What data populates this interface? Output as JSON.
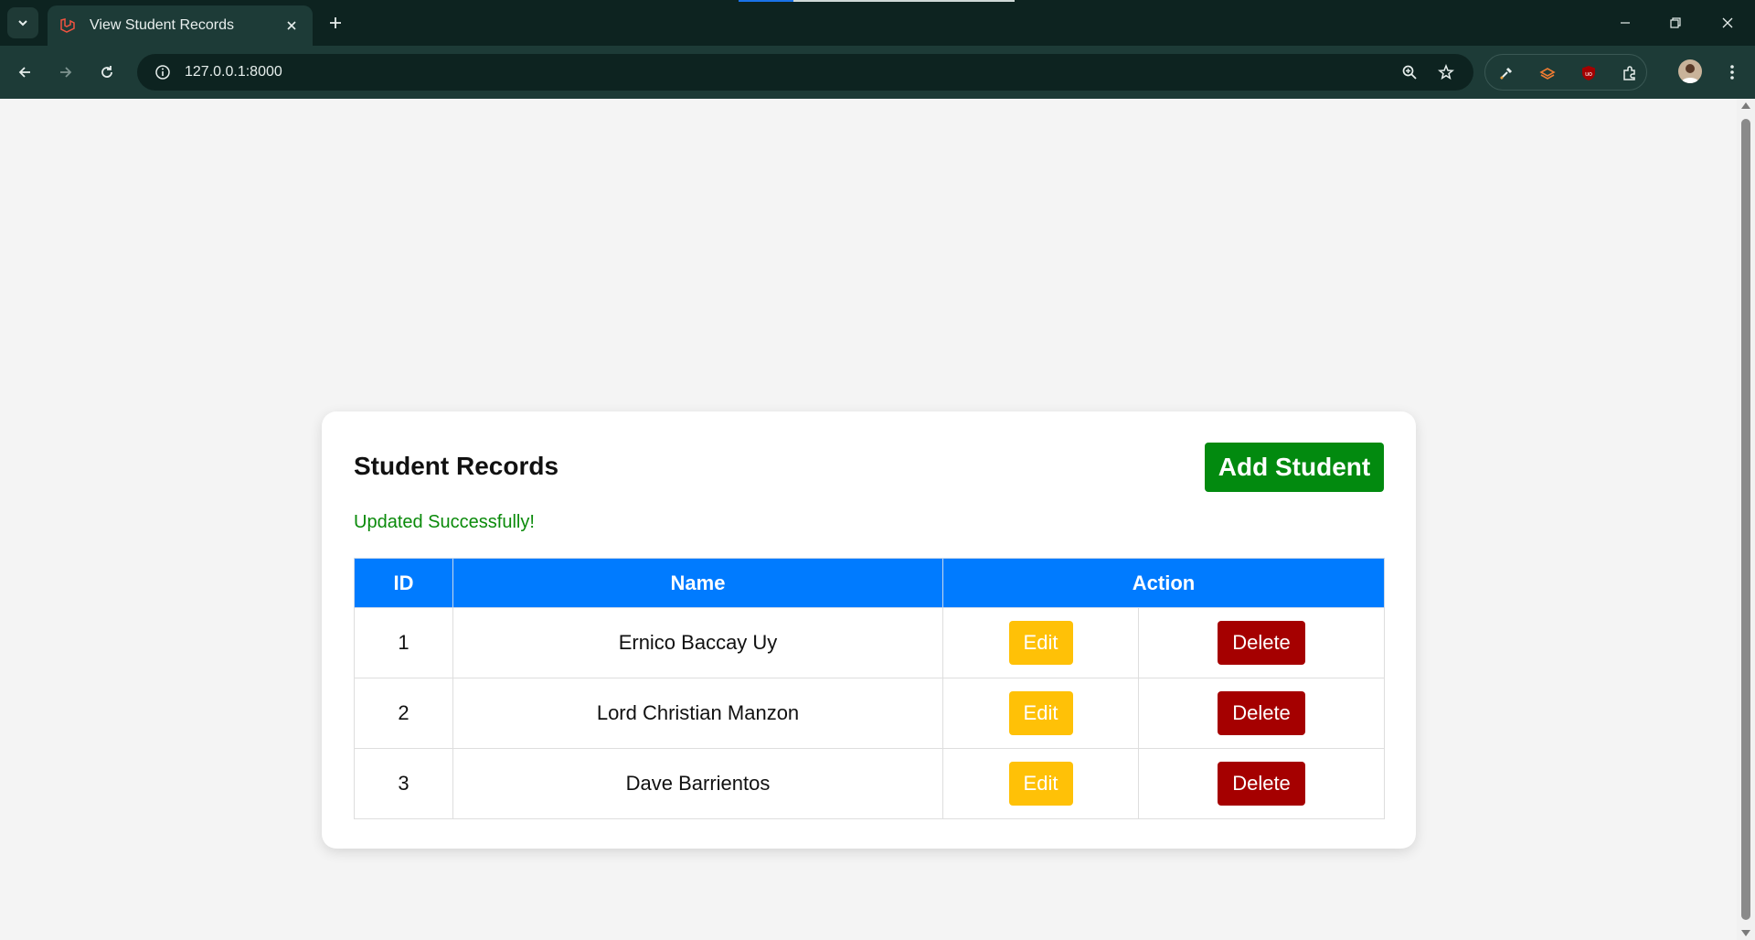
{
  "browser": {
    "tab_title": "View Student Records",
    "url": "127.0.0.1:8000"
  },
  "page": {
    "title": "Student Records",
    "add_button_label": "Add Student",
    "flash_message": "Updated Successfully!",
    "table": {
      "headers": {
        "id": "ID",
        "name": "Name",
        "action": "Action"
      },
      "rows": [
        {
          "id": "1",
          "name": "Ernico Baccay Uy",
          "edit": "Edit",
          "delete": "Delete"
        },
        {
          "id": "2",
          "name": "Lord Christian Manzon",
          "edit": "Edit",
          "delete": "Delete"
        },
        {
          "id": "3",
          "name": "Dave Barrientos",
          "edit": "Edit",
          "delete": "Delete"
        }
      ]
    }
  },
  "colors": {
    "header_bg": "#007bff",
    "add_button": "#028a0f",
    "flash_text": "#0a8a0a",
    "edit_button": "#ffc107",
    "delete_button": "#a50000",
    "browser_frame": "#0d2320",
    "browser_toolbar": "#1d3b37"
  },
  "icons": {
    "tab_search": "chevron-down-icon",
    "favicon": "laravel-icon",
    "tab_close": "close-icon",
    "new_tab": "plus-icon",
    "back": "arrow-left-icon",
    "forward": "arrow-right-icon",
    "reload": "reload-icon",
    "site_info": "info-icon",
    "zoom": "zoom-icon",
    "bookmark": "star-icon",
    "extensions": [
      "eyedropper-icon",
      "layers-icon",
      "ublock-icon",
      "puzzle-icon"
    ],
    "menu": "more-vertical-icon"
  }
}
